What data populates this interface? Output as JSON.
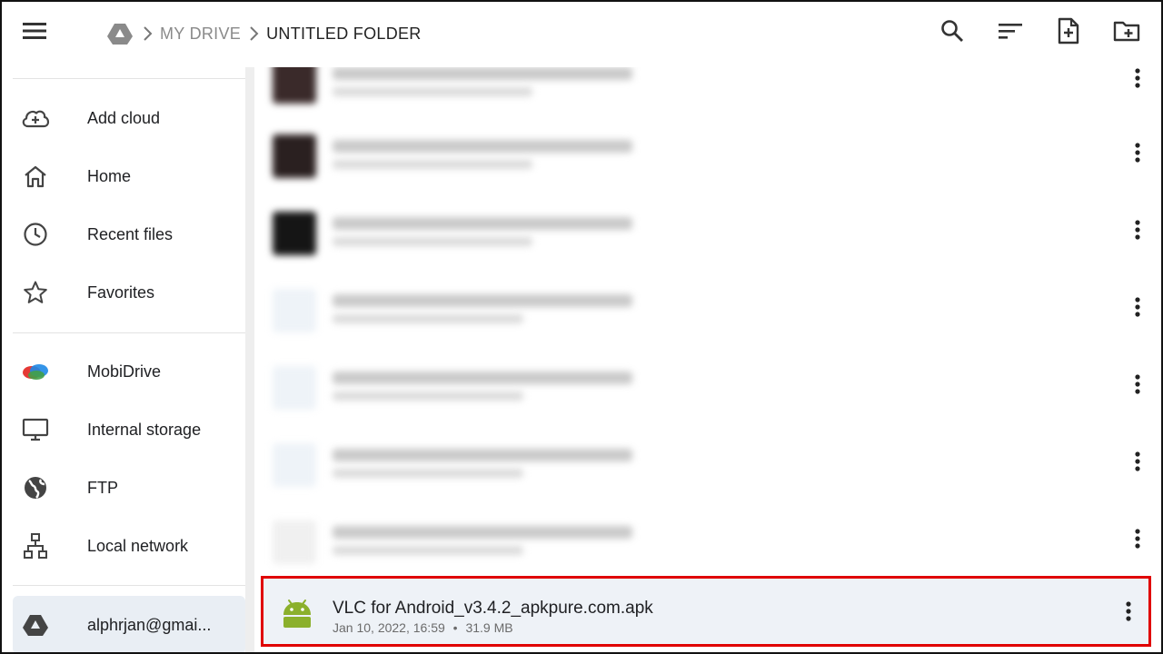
{
  "breadcrumb": {
    "root_icon": "drive-icon",
    "items": [
      "MY DRIVE",
      "UNTITLED FOLDER"
    ]
  },
  "toolbar": {
    "icons": [
      "menu-icon",
      "search-icon",
      "sort-icon",
      "new-file-icon",
      "new-folder-icon"
    ]
  },
  "sidebar": {
    "items": [
      {
        "label": "Add cloud",
        "icon": "cloud-add-icon"
      },
      {
        "label": "Home",
        "icon": "home-icon"
      },
      {
        "label": "Recent files",
        "icon": "clock-icon"
      },
      {
        "label": "Favorites",
        "icon": "star-icon"
      },
      {
        "label": "MobiDrive",
        "icon": "mobidrive-icon"
      },
      {
        "label": "Internal storage",
        "icon": "monitor-icon"
      },
      {
        "label": "FTP",
        "icon": "globe-icon"
      },
      {
        "label": "Local network",
        "icon": "network-icon"
      },
      {
        "label": "alphrjan@gmai...",
        "icon": "drive-icon"
      }
    ]
  },
  "files": {
    "selected": {
      "name": "VLC for Android_v3.4.2_apkpure.com.apk",
      "date": "Jan 10, 2022, 16:59",
      "separator": "•",
      "size": "31.9 MB",
      "icon": "android-icon"
    }
  },
  "colors": {
    "highlight_border": "#e00000",
    "selected_bg": "#eef2f7",
    "android_green": "#8bb02c"
  }
}
